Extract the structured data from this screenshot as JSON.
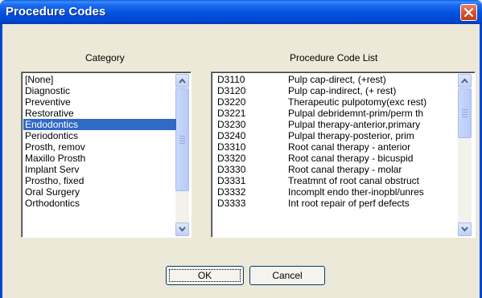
{
  "window": {
    "title": "Procedure Codes"
  },
  "category": {
    "heading": "Category",
    "items": [
      "[None]",
      "Diagnostic",
      "Preventive",
      "Restorative",
      "Endodontics",
      "Periodontics",
      "Prosth, remov",
      "Maxillo Prosth",
      "Implant Serv",
      "Prostho, fixed",
      "Oral Surgery",
      "Orthodontics"
    ],
    "selected": "Endodontics"
  },
  "procedure": {
    "heading": "Procedure Code List",
    "items": [
      {
        "code": "D3110",
        "desc": "Pulp cap-direct, (+rest)"
      },
      {
        "code": "D3120",
        "desc": "Pulp cap-indirect, (+ rest)"
      },
      {
        "code": "D3220",
        "desc": "Therapeutic pulpotomy(exc rest)"
      },
      {
        "code": "D3221",
        "desc": "Pulpal debridemnt-prim/perm th"
      },
      {
        "code": "D3230",
        "desc": "Pulpal therapy-anterior,primary"
      },
      {
        "code": "D3240",
        "desc": "Pulpal therapy-posterior, prim"
      },
      {
        "code": "D3310",
        "desc": "Root canal therapy - anterior"
      },
      {
        "code": "D3320",
        "desc": "Root canal therapy - bicuspid"
      },
      {
        "code": "D3330",
        "desc": "Root canal therapy - molar"
      },
      {
        "code": "D3331",
        "desc": "Treatmnt of root canal obstruct"
      },
      {
        "code": "D3332",
        "desc": "Incomplt endo ther-inopbl/unres"
      },
      {
        "code": "D3333",
        "desc": "Int root repair of perf defects"
      }
    ]
  },
  "buttons": {
    "ok": "OK",
    "cancel": "Cancel"
  },
  "icons": {
    "close": "close-icon",
    "scroll_up": "arrow-up-icon",
    "scroll_down": "arrow-down-icon"
  },
  "colors": {
    "titlebar": "#0052e0",
    "selection": "#316ac5",
    "face": "#ece9d8",
    "close": "#d8542e"
  }
}
